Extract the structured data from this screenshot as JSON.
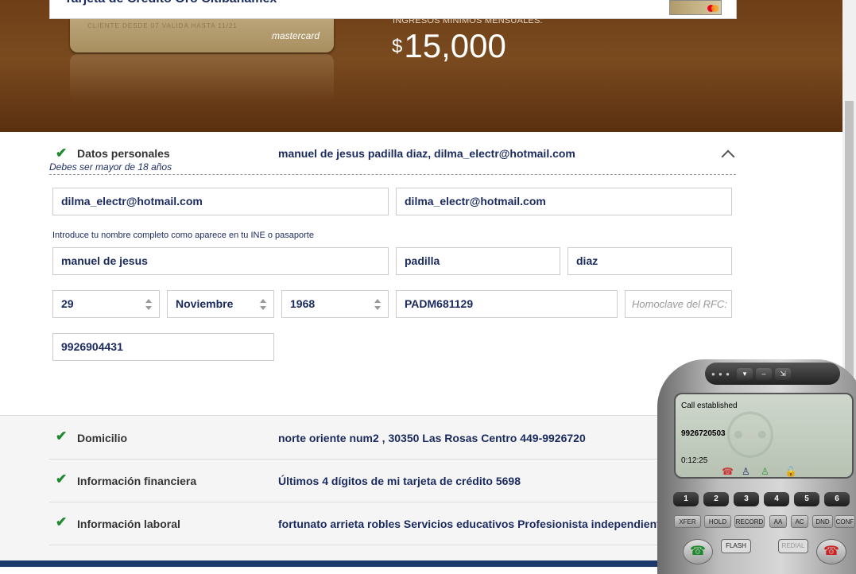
{
  "banner": {
    "card_title": "Tarjeta de Crédito Oro Citibanamex",
    "card_brand": "mastercard",
    "card_text": "CLIENTE DESDE   07   VALIDA HASTA   11/21",
    "income_label": "INGRESOS MÍNIMOS MENSUALES:",
    "income_currency": "$",
    "income_value": "15,000"
  },
  "personal": {
    "title": "Datos personales",
    "summary": "manuel de jesus padilla diaz, dilma_electr@hotmail.com",
    "subtitle": "Debes ser mayor de 18 años",
    "email": "dilma_electr@hotmail.com",
    "email_confirm": "dilma_electr@hotmail.com",
    "name_hint": "Introduce tu nombre completo como aparece en tu INE o pasaporte",
    "first_name": "manuel de jesus",
    "last_name1": "padilla",
    "last_name2": "diaz",
    "birth_day": "29",
    "birth_month": "Noviembre",
    "birth_year": "1968",
    "rfc": "PADM681129",
    "homoclave_placeholder": "Homoclave del RFC:",
    "phone": "9926904431"
  },
  "sections": [
    {
      "title": "Domicilio",
      "summary": "norte oriente num2 , 30350 Las Rosas Centro 449-9926720"
    },
    {
      "title": "Información financiera",
      "summary": "Últimos 4 dígitos de mi tarjeta de crédito 5698"
    },
    {
      "title": "Información laboral",
      "summary": "fortunato arrieta robles Servicios educativos Profesionista independiente"
    }
  ],
  "softphone": {
    "status": "Call established",
    "number": "9926720503",
    "timer": "0:12:25",
    "keys": [
      "1",
      "2",
      "3",
      "4",
      "5",
      "6"
    ],
    "fkeys": [
      "XFER",
      "HOLD",
      "RECORD",
      "AA",
      "AC",
      "DND",
      "CONF"
    ],
    "flash": "FLASH",
    "redial": "REDIAL"
  },
  "colors": {
    "accent_check": "#1e8a2e",
    "text_navy": "#1a2a5e",
    "banner_brown": "#6e3e17"
  }
}
